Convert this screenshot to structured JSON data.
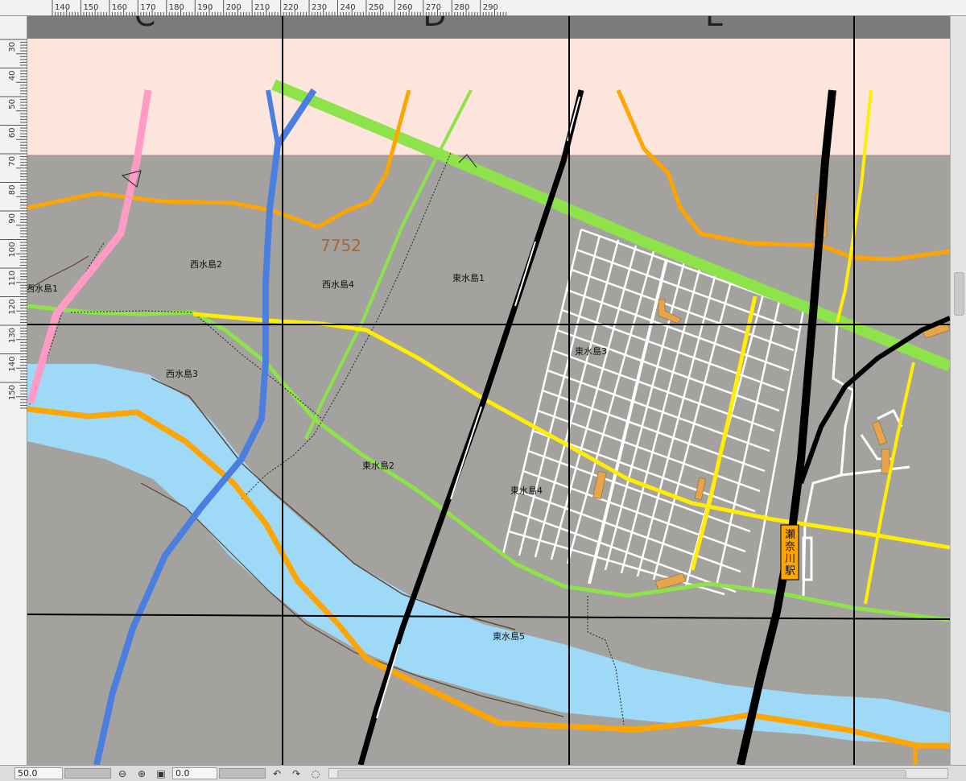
{
  "rulers": {
    "top": [
      "140",
      "150",
      "160",
      "170",
      "180",
      "190",
      "200",
      "210",
      "220",
      "230",
      "240",
      "250",
      "260",
      "270",
      "280",
      "290"
    ],
    "left": [
      "30",
      "40",
      "50",
      "60",
      "70",
      "80",
      "90",
      "100",
      "110",
      "120",
      "130",
      "140",
      "150"
    ]
  },
  "grid_letters": [
    "C",
    "D",
    "E"
  ],
  "districts": {
    "nishimizushima1": "西水島1",
    "nishimizushima2": "西水島2",
    "nishimizushima3": "西水島3",
    "nishimizushima4": "西水島4",
    "higashimizushima1": "東水島1",
    "higashimizushima2": "東水島2",
    "higashimizushima3": "東水島3",
    "higashimizushima4": "東水島4",
    "higashimizushima5": "東水島5"
  },
  "station": {
    "name": "瀬奈川駅"
  },
  "sketch_note": "7752",
  "colors": {
    "background": "#a3a29e",
    "river": "#9ed9f7",
    "band": "#fde4dc",
    "road_orange": "#ffa500",
    "road_green": "#8ee24a",
    "road_yellow": "#ffee00",
    "road_blue": "#4a7fe0",
    "road_pink": "#ff9bc4",
    "rail": "#000000",
    "building": "#e8a44a"
  },
  "statusbar": {
    "zoom": "50.0",
    "rotation": "0.0",
    "zoom_out_icon": "zoom-out-icon",
    "zoom_in_icon": "zoom-in-icon",
    "fit_icon": "fit-screen-icon",
    "undo_icon": "undo-icon",
    "redo_icon": "redo-icon",
    "reset_icon": "reset-rotation-icon"
  }
}
